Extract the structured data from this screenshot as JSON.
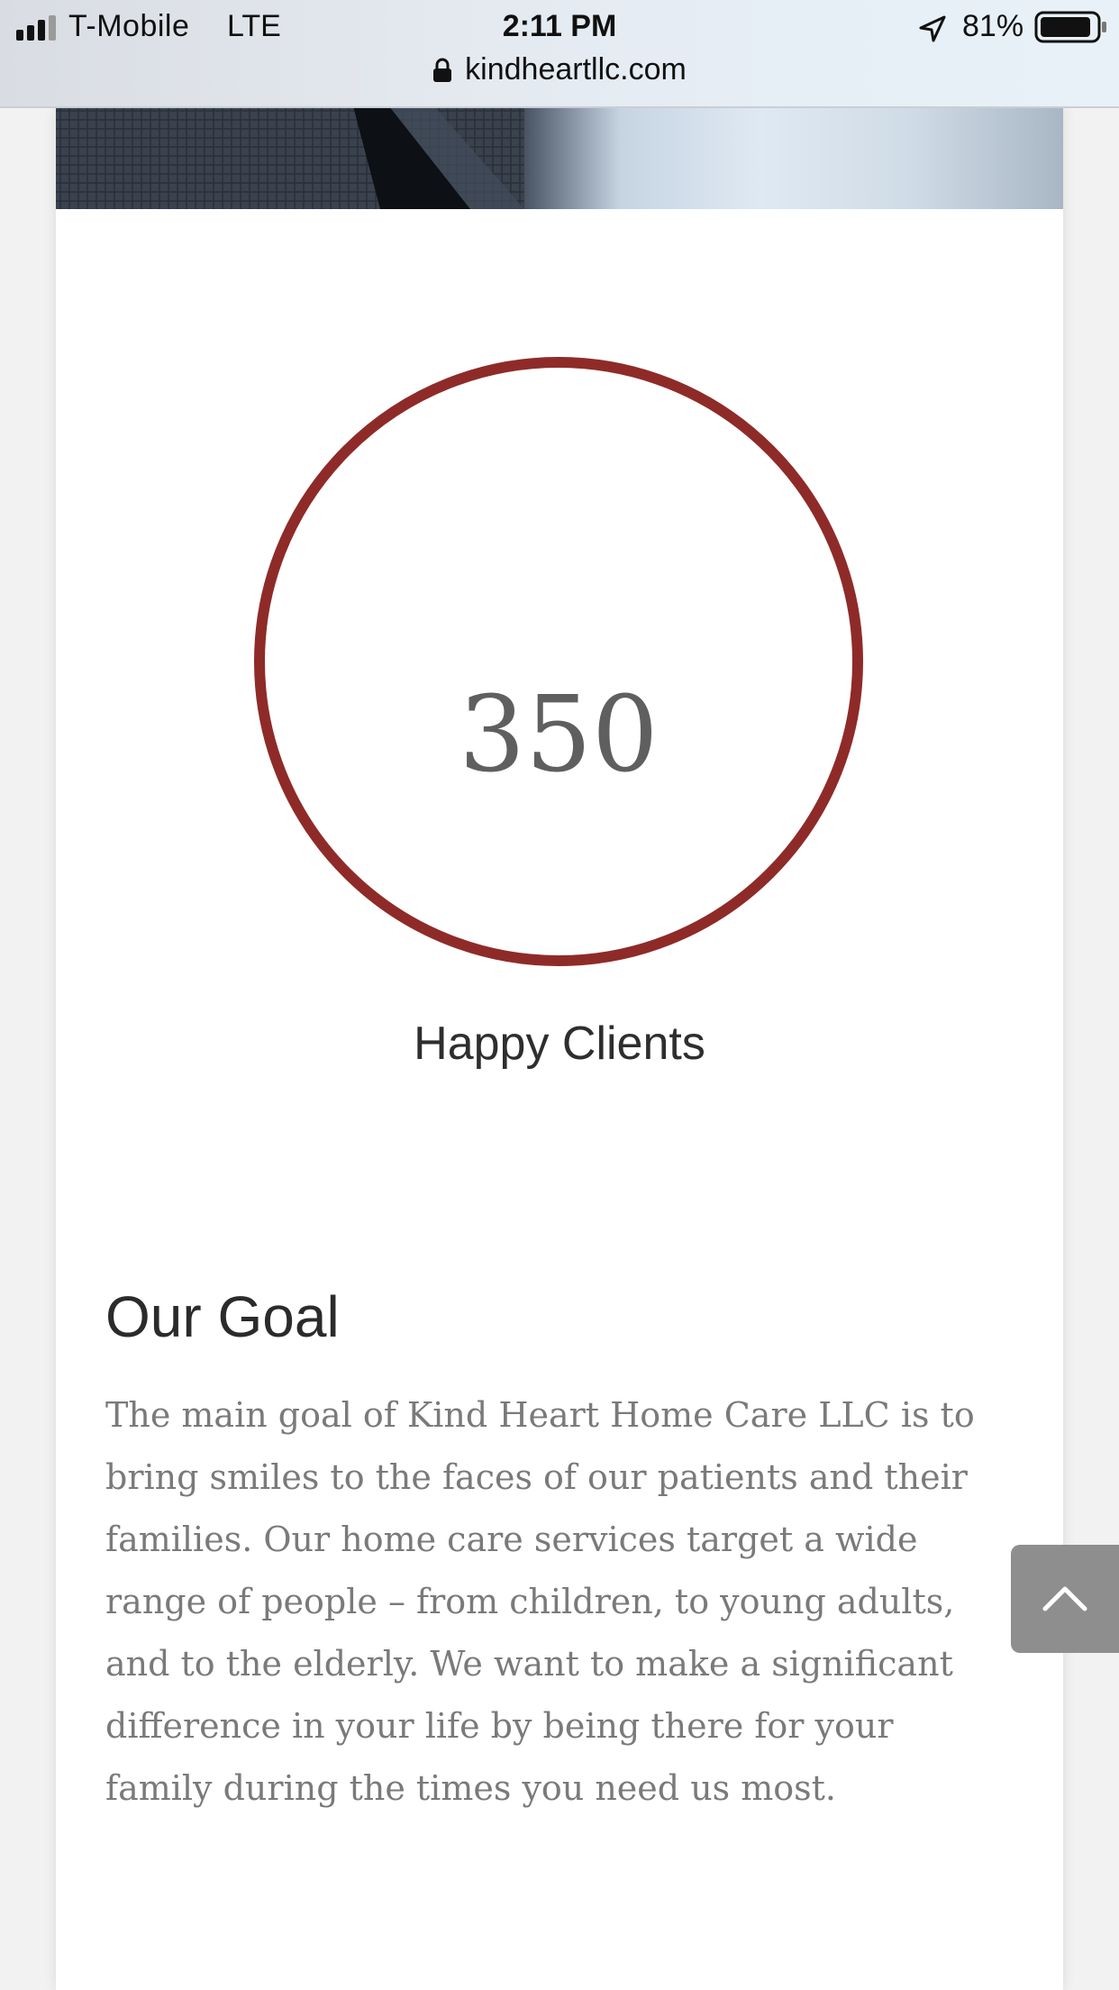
{
  "status_bar": {
    "carrier": "T-Mobile",
    "network": "LTE",
    "time": "2:11 PM",
    "battery_percent": "81%",
    "icons": [
      "signal-bars-icon",
      "location-arrow-icon",
      "battery-icon"
    ]
  },
  "browser": {
    "url": "kindheartllc.com",
    "icons": [
      "lock-icon"
    ]
  },
  "counter": {
    "value": "350",
    "label": "Happy Clients",
    "ring_color": "#8e2b28"
  },
  "goal": {
    "heading": "Our Goal",
    "body": "The main goal of Kind Heart Home Care LLC is to bring smiles to the faces of our patients and their families. Our home care services target a wide range of people – from children, to young adults, and to the elderly. We want to make a significant difference in your life by being there for your family during the times you need us most."
  },
  "scroll_top": {
    "icon": "chevron-up-icon",
    "color": "#8e8e8e"
  }
}
